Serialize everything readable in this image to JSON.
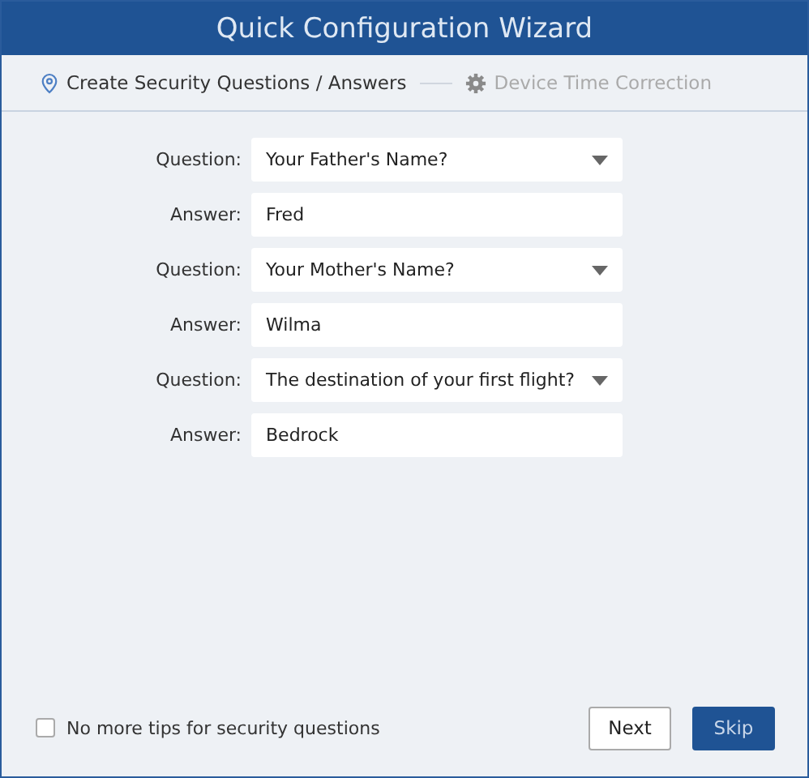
{
  "window": {
    "title": "Quick Configuration Wizard"
  },
  "steps": [
    {
      "label": "Create Security Questions / Answers",
      "selected": true
    },
    {
      "label": "Device Time Correction",
      "selected": false
    }
  ],
  "fields": [
    {
      "kind": "select",
      "label": "Question:",
      "value": "Your Father's Name?"
    },
    {
      "kind": "text",
      "label": "Answer:",
      "value": "Fred"
    },
    {
      "kind": "select",
      "label": "Question:",
      "value": "Your Mother's Name?"
    },
    {
      "kind": "text",
      "label": "Answer:",
      "value": "Wilma"
    },
    {
      "kind": "select",
      "label": "Question:",
      "value": "The destination of your first flight?"
    },
    {
      "kind": "text",
      "label": "Answer:",
      "value": "Bedrock"
    }
  ],
  "tips_checkbox": {
    "label": "No more tips for security questions",
    "checked": false
  },
  "buttons": [
    {
      "kind": "secondary",
      "label": "Next"
    },
    {
      "kind": "primary",
      "label": "Skip"
    }
  ]
}
